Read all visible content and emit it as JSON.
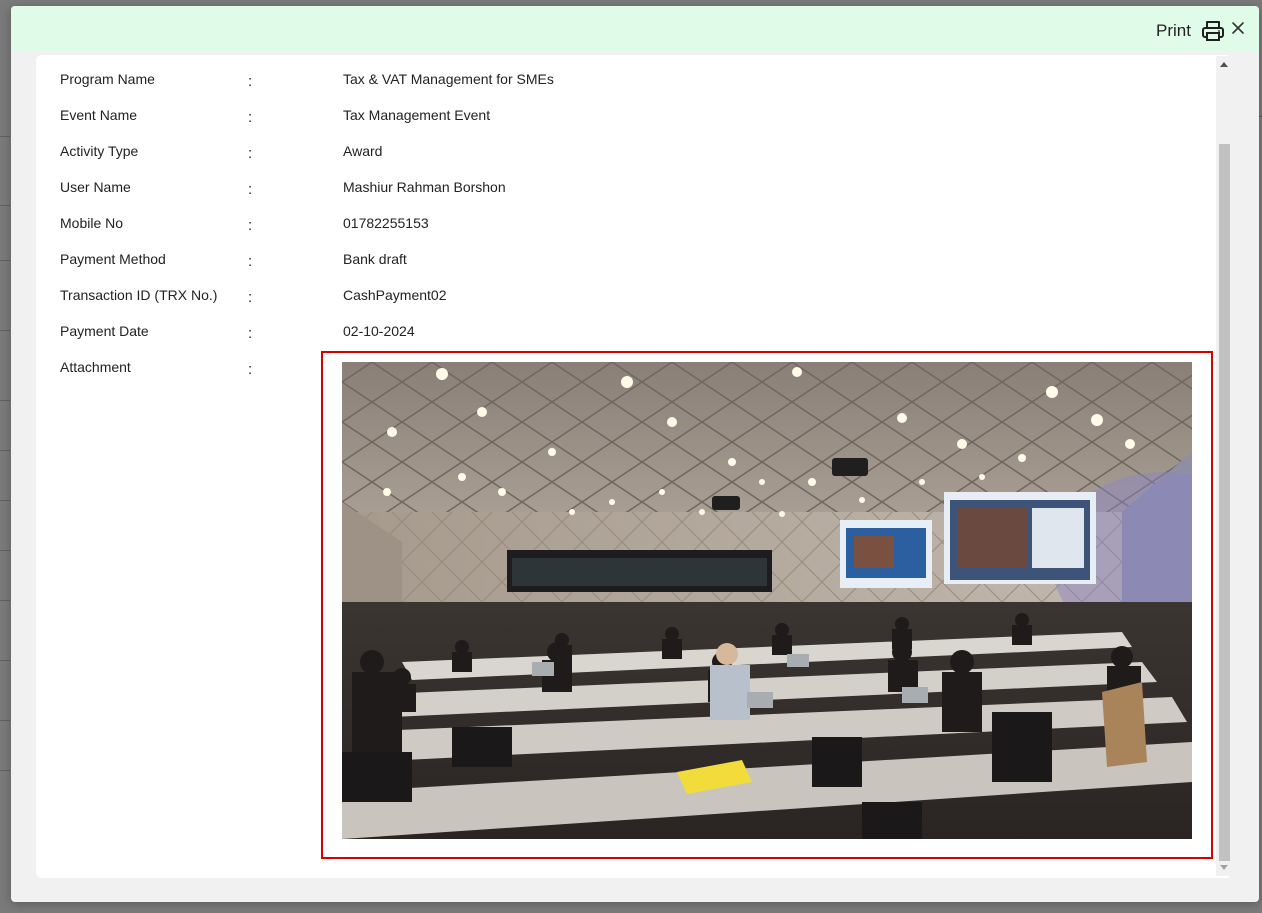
{
  "header": {
    "print_label": "Print",
    "print_icon": "printer-icon",
    "close_icon": "close-icon",
    "background_color": "#e1fbe9"
  },
  "details": [
    {
      "label": "Program Name",
      "colon": ":",
      "value": "Tax & VAT Management for SMEs"
    },
    {
      "label": "Event Name",
      "colon": ":",
      "value": "Tax Management Event"
    },
    {
      "label": "Activity Type",
      "colon": ":",
      "value": "Award"
    },
    {
      "label": "User Name",
      "colon": ":",
      "value": "Mashiur Rahman Borshon"
    },
    {
      "label": "Mobile No",
      "colon": ":",
      "value": "01782255153"
    },
    {
      "label": "Payment Method",
      "colon": ":",
      "value": "Bank draft"
    },
    {
      "label": "Transaction ID (TRX No.)",
      "colon": ":",
      "value": "CashPayment02"
    },
    {
      "label": "Payment Date",
      "colon": ":",
      "value": "02-10-2024"
    }
  ],
  "attachment": {
    "label": "Attachment",
    "colon": ":",
    "highlight_color": "#d90000"
  }
}
